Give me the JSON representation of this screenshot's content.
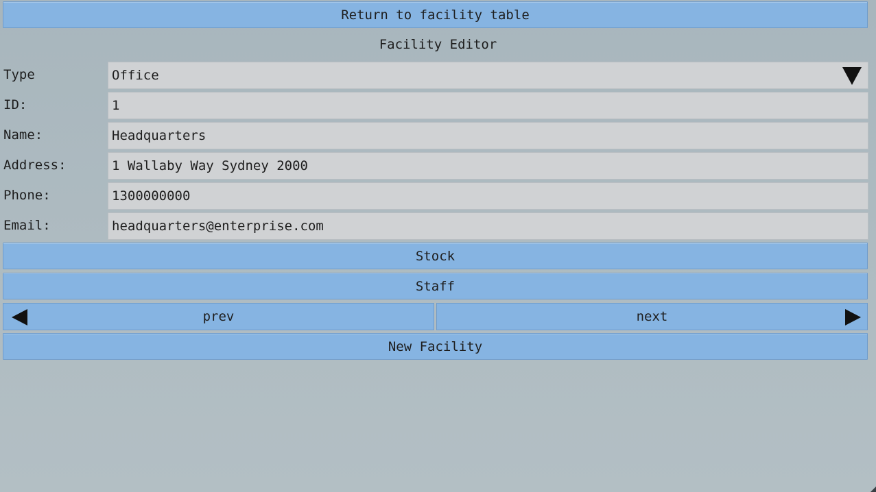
{
  "header": {
    "return_label": "Return to facility table",
    "title": "Facility Editor"
  },
  "form": {
    "type": {
      "label": "Type",
      "value": "Office",
      "icon": "dropdown-arrow-icon"
    },
    "id": {
      "label": "ID:",
      "value": "1"
    },
    "name": {
      "label": "Name:",
      "value": "Headquarters"
    },
    "address": {
      "label": "Address:",
      "value": "1 Wallaby Way Sydney 2000"
    },
    "phone": {
      "label": "Phone:",
      "value": "1300000000"
    },
    "email": {
      "label": "Email:",
      "value": "headquarters@enterprise.com"
    }
  },
  "actions": {
    "stock_label": "Stock",
    "staff_label": "Staff",
    "prev_label": "prev",
    "next_label": "next",
    "new_label": "New Facility"
  },
  "colors": {
    "button": "#86b4e2",
    "field": "#d0d2d4",
    "background": "#aebbc1"
  }
}
